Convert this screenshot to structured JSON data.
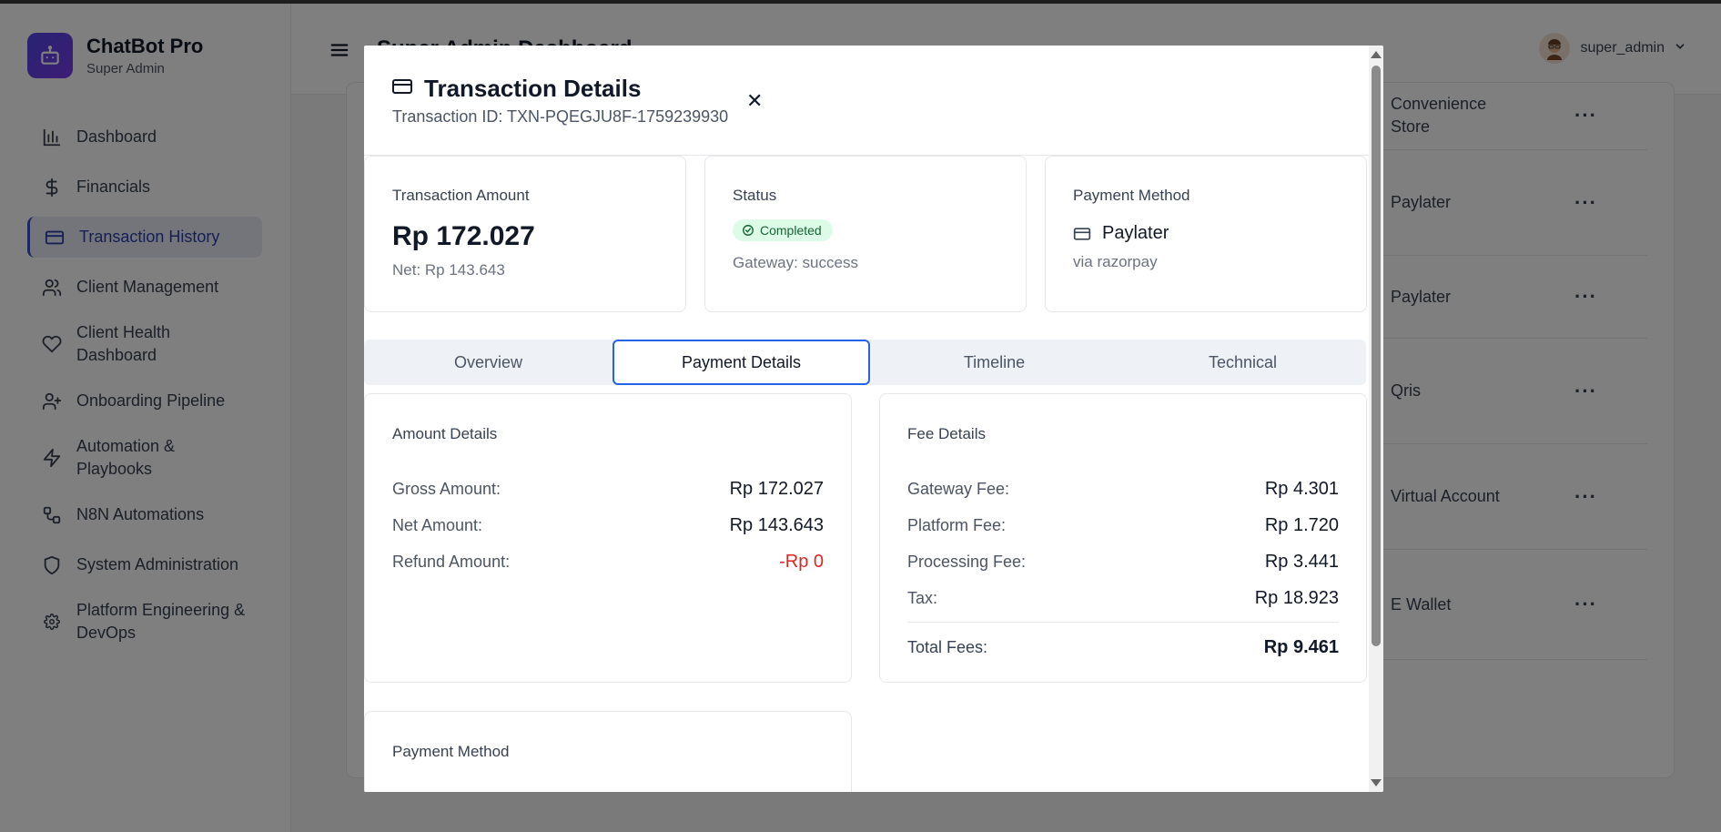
{
  "app": {
    "name": "ChatBot Pro",
    "role": "Super Admin"
  },
  "sidebar": {
    "items": [
      {
        "label": "Dashboard",
        "icon": "bar-chart-icon"
      },
      {
        "label": "Financials",
        "icon": "dollar-icon"
      },
      {
        "label": "Transaction History",
        "icon": "credit-card-icon",
        "active": true
      },
      {
        "label": "Client Management",
        "icon": "users-icon"
      },
      {
        "label": "Client Health Dashboard",
        "icon": "heart-icon"
      },
      {
        "label": "Onboarding Pipeline",
        "icon": "user-plus-icon"
      },
      {
        "label": "Automation & Playbooks",
        "icon": "zap-icon"
      },
      {
        "label": "N8N Automations",
        "icon": "workflow-icon"
      },
      {
        "label": "System Administration",
        "icon": "shield-icon"
      },
      {
        "label": "Platform Engineering & DevOps",
        "icon": "gear-icon"
      }
    ]
  },
  "header": {
    "title": "Super Admin Dashboard",
    "user": "super_admin"
  },
  "background_table": {
    "payment_methods": [
      "Convenience Store",
      "Paylater",
      "Paylater",
      "Qris",
      "Virtual Account",
      "E Wallet"
    ],
    "actions_label": "···"
  },
  "modal": {
    "title": "Transaction Details",
    "transaction_id": "Transaction ID: TXN-PQEGJU8F-1759239930",
    "close_label": "✕",
    "amount_card": {
      "label": "Transaction Amount",
      "amount": "Rp 172.027",
      "net": "Net: Rp 143.643"
    },
    "status_card": {
      "label": "Status",
      "badge": "Completed",
      "gateway": "Gateway: success"
    },
    "method_card": {
      "label": "Payment Method",
      "method": "Paylater",
      "via": "via razorpay"
    },
    "tabs": [
      "Overview",
      "Payment Details",
      "Timeline",
      "Technical"
    ],
    "active_tab": "Payment Details",
    "amount_details": {
      "title": "Amount Details",
      "rows": [
        {
          "label": "Gross Amount:",
          "value": "Rp 172.027"
        },
        {
          "label": "Net Amount:",
          "value": "Rp 143.643"
        },
        {
          "label": "Refund Amount:",
          "value": "-Rp 0"
        }
      ]
    },
    "fee_details": {
      "title": "Fee Details",
      "rows": [
        {
          "label": "Gateway Fee:",
          "value": "Rp 4.301"
        },
        {
          "label": "Platform Fee:",
          "value": "Rp 1.720"
        },
        {
          "label": "Processing Fee:",
          "value": "Rp 3.441"
        },
        {
          "label": "Tax:",
          "value": "Rp 18.923"
        }
      ],
      "total": {
        "label": "Total Fees:",
        "value": "Rp 9.461"
      }
    },
    "payment_method_section": {
      "title": "Payment Method"
    }
  },
  "colors": {
    "accent": "#2563eb",
    "brand": "#4f46e5",
    "success_bg": "#dcfce7",
    "success_text": "#166534",
    "negative": "#dc2626"
  }
}
